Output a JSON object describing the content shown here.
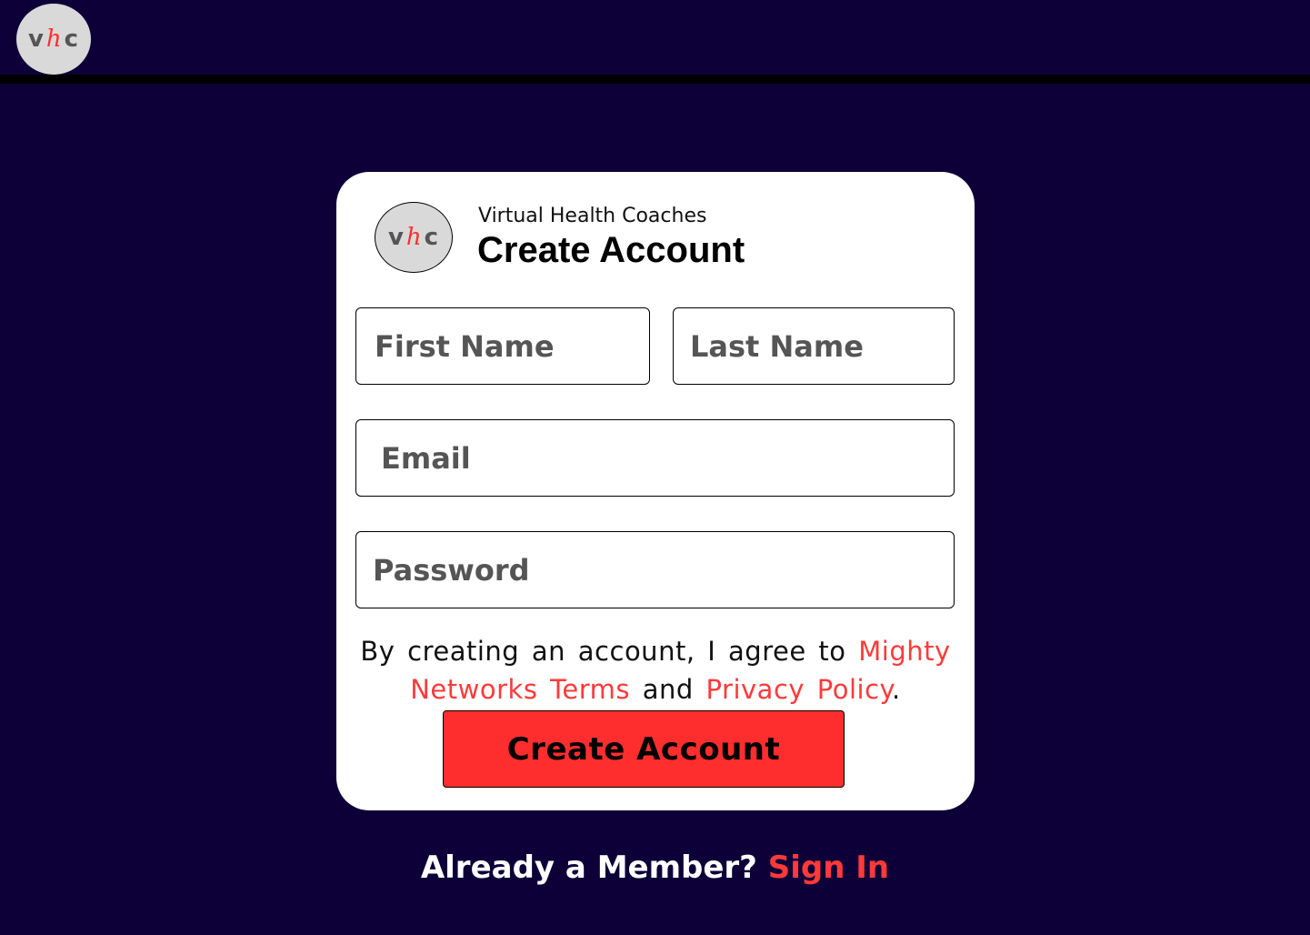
{
  "logo": {
    "left_letter": "v",
    "middle_letter": "h",
    "right_letter": "c"
  },
  "card": {
    "brand": "Virtual Health Coaches",
    "title": "Create Account"
  },
  "form": {
    "first_name_placeholder": "First Name",
    "last_name_placeholder": "Last Name",
    "email_placeholder": "Email",
    "password_placeholder": "Password"
  },
  "terms": {
    "prefix": "By creating an account, I agree to ",
    "terms_link": "Mighty Networks Terms",
    "conjunction": " and ",
    "privacy_link": "Privacy Policy",
    "suffix": "."
  },
  "actions": {
    "create_account_label": "Create Account"
  },
  "footer": {
    "member_prompt": "Already a Member? ",
    "sign_in_label": "Sign In"
  },
  "colors": {
    "background": "#0d0038",
    "accent": "#ff2e2e",
    "card": "#ffffff",
    "logo_background": "#d9d9d9"
  }
}
